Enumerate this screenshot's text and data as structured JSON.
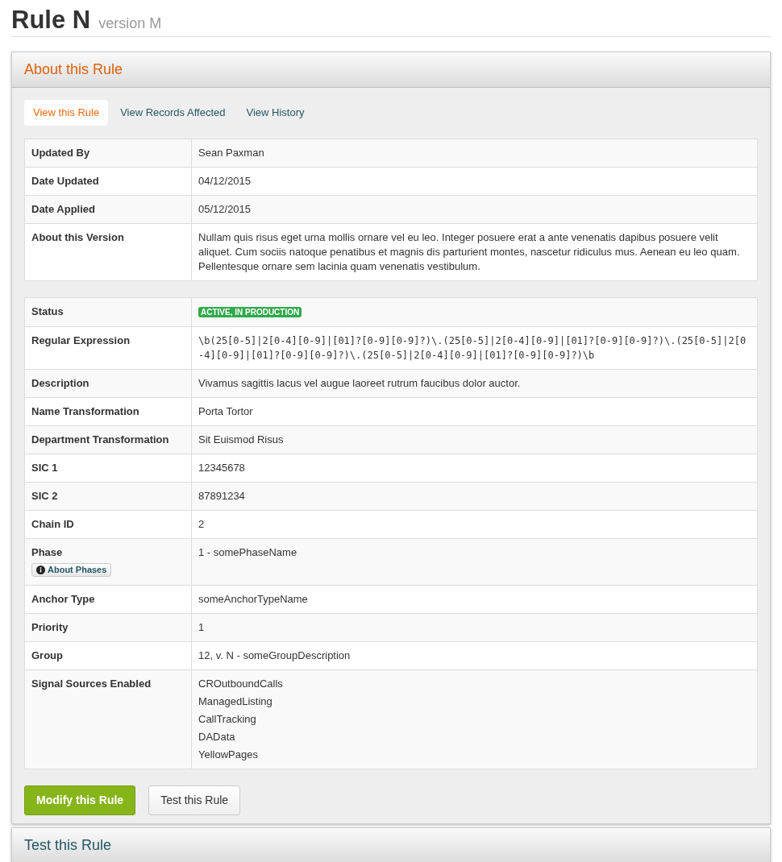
{
  "page_title": {
    "title": "Rule N",
    "subtitle": "version M"
  },
  "panel": {
    "title": "About this Rule"
  },
  "tabs": [
    {
      "label": "View this Rule",
      "selected": true
    },
    {
      "label": "View Records Affected",
      "selected": false
    },
    {
      "label": "View History",
      "selected": false
    }
  ],
  "tables": [
    {
      "rows": [
        {
          "label": "Updated By",
          "kind": "text",
          "value": "Sean Paxman"
        },
        {
          "label": "Date Updated",
          "kind": "text",
          "value": "04/12/2015"
        },
        {
          "label": "Date Applied",
          "kind": "text",
          "value": "05/12/2015"
        },
        {
          "label": "About this Version",
          "kind": "text",
          "value": "Nullam quis risus eget urna mollis ornare vel eu leo. Integer posuere erat a ante venenatis dapibus posuere velit aliquet. Cum sociis natoque penatibus et magnis dis parturient montes, nascetur ridiculus mus. Aenean eu leo quam. Pellentesque ornare sem lacinia quam venenatis vestibulum."
        }
      ]
    },
    {
      "rows": [
        {
          "label": "Status",
          "kind": "badge",
          "value": "ACTIVE, IN PRODUCTION",
          "color": "#2eaa4a"
        },
        {
          "label": "Regular Expression",
          "kind": "code",
          "value": "\\b(25[0-5]|2[0-4][0-9]|[01]?[0-9][0-9]?)\\.(25[0-5]|2[0-4][0-9]|[01]?[0-9][0-9]?)\\.(25[0-5]|2[0-4][0-9]|[01]?[0-9][0-9]?)\\.(25[0-5]|2[0-4][0-9]|[01]?[0-9][0-9]?)\\b"
        },
        {
          "label": "Description",
          "kind": "text",
          "value": "Vivamus sagittis lacus vel augue laoreet rutrum faucibus dolor auctor."
        },
        {
          "label": "Name Transformation",
          "kind": "text",
          "value": "Porta Tortor"
        },
        {
          "label": "Department Transformation",
          "kind": "text",
          "value": "Sit Euismod Risus"
        },
        {
          "label": "SIC 1",
          "kind": "text",
          "value": "12345678"
        },
        {
          "label": "SIC 2",
          "kind": "text",
          "value": "87891234"
        },
        {
          "label": "Chain ID",
          "kind": "text",
          "value": "2"
        },
        {
          "label": "Phase",
          "kind": "text",
          "value": "1 - somePhaseName",
          "help_button": "About Phases"
        },
        {
          "label": "Anchor Type",
          "kind": "text",
          "value": "someAnchorTypeName"
        },
        {
          "label": "Priority",
          "kind": "text",
          "value": "1"
        },
        {
          "label": "Group",
          "kind": "text",
          "value": "12, v. N - someGroupDescription"
        },
        {
          "label": "Signal Sources Enabled",
          "kind": "list",
          "values": [
            "CROutboundCalls",
            "ManagedListing",
            "CallTracking",
            "DAData",
            "YellowPages"
          ]
        }
      ]
    }
  ],
  "actions": [
    {
      "label": "Modify this Rule",
      "kind": "primary"
    },
    {
      "label": "Test this Rule",
      "kind": "default"
    }
  ],
  "collapsed_panel": {
    "title": "Test this Rule"
  }
}
